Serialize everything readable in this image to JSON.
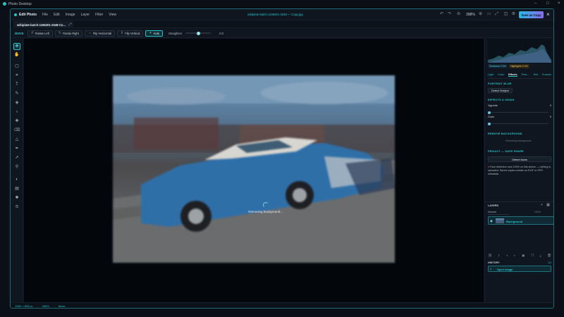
{
  "window": {
    "title": "Photo Desktop"
  },
  "menubar": {
    "brand": "Edit Photo",
    "items": [
      "File",
      "Edit",
      "Image",
      "Layer",
      "Filter",
      "View"
    ],
    "doc_title": "wikiplate-batch-1165201-2048 — Copy.jpg",
    "zoom": "398%",
    "save_label": "Save as Copy"
  },
  "tabs": [
    {
      "label": "wikiplate-batch-1165201-2048-Co...",
      "close": "×"
    }
  ],
  "tab_add": "+",
  "options": {
    "tool_name": "MOVE",
    "buttons": [
      {
        "label": "Rotate Left",
        "icon": "rotate-left-icon"
      },
      {
        "label": "Rotate Right",
        "icon": "rotate-right-icon"
      },
      {
        "label": "Flip Horizontal",
        "icon": "flip-horizontal-icon"
      },
      {
        "label": "Flip Vertical",
        "icon": "flip-vertical-icon"
      },
      {
        "label": "Auto",
        "icon": "auto-icon"
      }
    ],
    "straighten_label": "Straighten",
    "straighten_value": "0.0",
    "straighten_fraction": 0.5
  },
  "tools": [
    "move-icon",
    "hand-icon",
    "marquee-icon",
    "crop-icon",
    "text-icon",
    "brush-icon",
    "fill-icon",
    "clone-icon",
    "heal-icon",
    "eraser-icon",
    "shape-icon",
    "pen-icon",
    "select-icon",
    "eyedropper-icon",
    "dodge-icon",
    "gradient-icon",
    "adjust-icon",
    "history-icon"
  ],
  "canvas": {
    "status_message": "Removing background…"
  },
  "statusbar": {
    "dimensions": "1280 × 853 px",
    "zoom": "398%",
    "mode": "Move"
  },
  "right_panel": {
    "histogram_tags": {
      "shadows": "Shadows 0.0%",
      "highlights": "Highlights 0.4%"
    },
    "tabs": [
      "Light",
      "Color",
      "Effects",
      "Pres...",
      "Text",
      "Frames"
    ],
    "active_tab": "Effects",
    "portrait_blur": {
      "title": "PORTRAIT BLUR",
      "button": "Detect Subject"
    },
    "effects": {
      "title": "EFFECTS & GRAIN",
      "vignette_label": "Vignette",
      "vignette_value": "0",
      "grain_label": "Grain",
      "grain_value": "0"
    },
    "remove_bg": {
      "title": "REMOVE BACKGROUND",
      "status": "Removing background…"
    },
    "privacy": {
      "title": "PRIVACY — SAFE SHARE",
      "button": "Detect faces",
      "note": "Face detection runs 100% on this device — nothing is uploaded. Saved copies contain no EXIF or GPS metadata."
    },
    "layers": {
      "title": "LAYERS",
      "blend_mode": "Normal",
      "opacity": "100%",
      "items": [
        {
          "name": "Background"
        }
      ]
    },
    "history": {
      "title": "HISTORY",
      "count": "1/1",
      "items": [
        {
          "index": "1",
          "label": "Open image"
        }
      ]
    }
  },
  "colors": {
    "accent": "#27c2c8",
    "brand_gradient_start": "#27b7e0",
    "brand_gradient_end": "#8a6cf0",
    "background": "#0d131c"
  }
}
